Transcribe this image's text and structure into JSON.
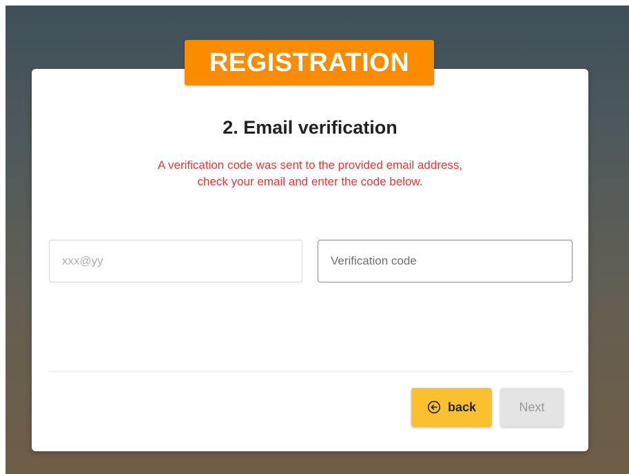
{
  "banner": {
    "title": "REGISTRATION"
  },
  "step": {
    "title": "2. Email verification",
    "notice_line1": "A verification code was sent to the provided email address,",
    "notice_line2": "check your email and enter the code below."
  },
  "form": {
    "email": {
      "placeholder": "xxx@yy",
      "value": ""
    },
    "code": {
      "placeholder": "Verification code",
      "value": ""
    }
  },
  "actions": {
    "back_label": "back",
    "back_icon": "arrow-left-circle-icon",
    "next_label": "Next"
  },
  "colors": {
    "accent_orange": "#fb8c00",
    "button_yellow": "#fbc02d",
    "notice_red": "#e53935"
  }
}
